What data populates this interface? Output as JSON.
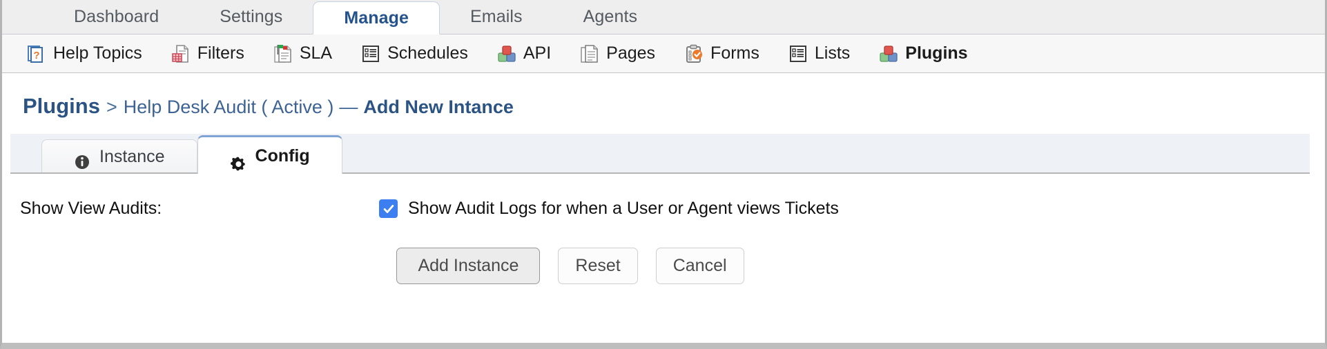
{
  "primary_nav": {
    "items": [
      {
        "label": "Dashboard",
        "active": false
      },
      {
        "label": "Settings",
        "active": false
      },
      {
        "label": "Manage",
        "active": true
      },
      {
        "label": "Emails",
        "active": false
      },
      {
        "label": "Agents",
        "active": false
      }
    ]
  },
  "secondary_nav": {
    "items": [
      {
        "label": "Help Topics",
        "icon": "help-topics-icon",
        "active": false
      },
      {
        "label": "Filters",
        "icon": "filters-icon",
        "active": false
      },
      {
        "label": "SLA",
        "icon": "sla-icon",
        "active": false
      },
      {
        "label": "Schedules",
        "icon": "schedules-icon",
        "active": false
      },
      {
        "label": "API",
        "icon": "api-icon",
        "active": false
      },
      {
        "label": "Pages",
        "icon": "pages-icon",
        "active": false
      },
      {
        "label": "Forms",
        "icon": "forms-icon",
        "active": false
      },
      {
        "label": "Lists",
        "icon": "lists-icon",
        "active": false
      },
      {
        "label": "Plugins",
        "icon": "plugins-icon",
        "active": true
      }
    ]
  },
  "breadcrumb": {
    "root": "Plugins",
    "separator": ">",
    "middle": "Help Desk Audit ( Active )",
    "dash": "—",
    "current": "Add New Intance"
  },
  "tabs": [
    {
      "label": "Instance",
      "icon": "info-icon",
      "active": false
    },
    {
      "label": "Config",
      "icon": "gear-icon",
      "active": true
    }
  ],
  "form": {
    "rows": [
      {
        "label": "Show View Audits:",
        "checkbox_label": "Show Audit Logs for when a User or Agent views Tickets",
        "checked": true
      }
    ]
  },
  "buttons": {
    "submit": "Add Instance",
    "reset": "Reset",
    "cancel": "Cancel"
  },
  "colors": {
    "active_tab_text": "#24528c",
    "breadcrumb_blue": "#2b5484",
    "checkbox_blue": "#3d7ef0",
    "nav_background": "#eeeeee",
    "subnav_background": "#f7f7f7",
    "tabstrip_background": "#eef1f5"
  }
}
